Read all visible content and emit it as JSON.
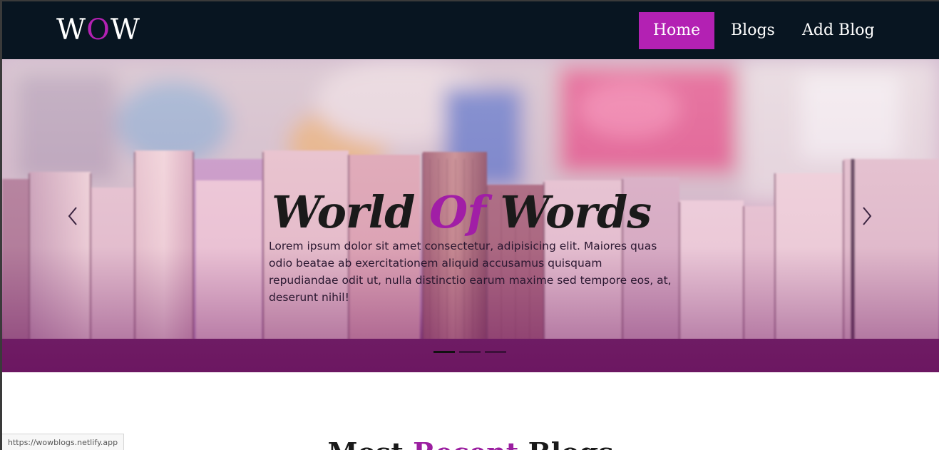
{
  "navbar": {
    "brand": {
      "part1": "W",
      "accent": "O",
      "part2": "W"
    },
    "items": [
      {
        "label": "Home",
        "active": true
      },
      {
        "label": "Blogs",
        "active": false
      },
      {
        "label": "Add Blog",
        "active": false
      }
    ]
  },
  "hero": {
    "title": {
      "part1": "World ",
      "accent": "Of",
      "part2": " Words"
    },
    "text": "Lorem ipsum dolor sit amet consectetur, adipisicing elit. Maiores quas odio beatae ab exercitationem aliquid accusamus quisquam repudiandae odit ut, nulla distinctio earum maxime sed tempore eos, at, deserunt nihil!",
    "prev_icon": "chevron-left-icon",
    "next_icon": "chevron-right-icon",
    "slide_count": 3,
    "active_slide": 1
  },
  "section": {
    "title": {
      "part1": "Most ",
      "accent": "Recent",
      "part2": " Blogs"
    }
  },
  "status_bar": {
    "url": "https://wowblogs.netlify.app"
  },
  "colors": {
    "navbar_bg": "#081521",
    "accent": "#b321b3",
    "text_dark": "#1a1a1a"
  }
}
